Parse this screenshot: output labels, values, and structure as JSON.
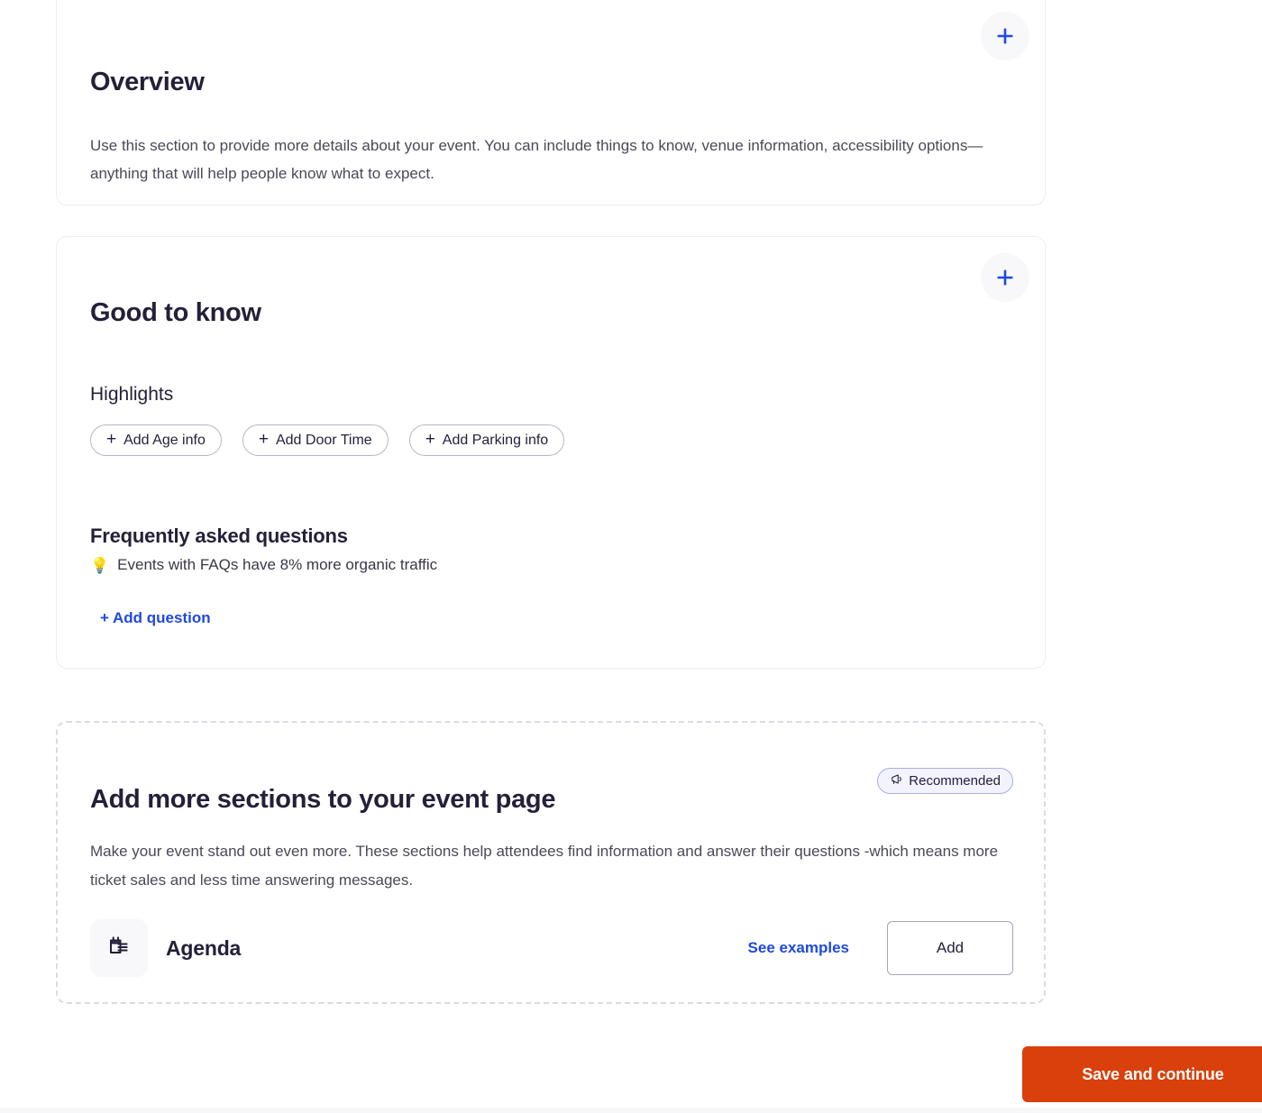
{
  "overview": {
    "title": "Overview",
    "description": "Use this section to provide more details about your event. You can include things to know, venue information, accessibility options—anything that will help people know what to expect.",
    "add_icon": "plus-icon"
  },
  "good_to_know": {
    "title": "Good to know",
    "add_icon": "plus-icon",
    "highlights": {
      "heading": "Highlights",
      "chips": [
        {
          "plus": "+",
          "label": "Add Age info"
        },
        {
          "plus": "+",
          "label": "Add Door Time"
        },
        {
          "plus": "+",
          "label": "Add Parking info"
        }
      ]
    },
    "faq": {
      "heading": "Frequently asked questions",
      "tip_icon": "💡",
      "tip_text": "Events with FAQs have 8% more organic traffic",
      "add_question_label": "+ Add question"
    }
  },
  "more_sections": {
    "title": "Add more sections to your event page",
    "badge": {
      "icon": "megaphone-icon",
      "label": "Recommended"
    },
    "description": "Make your event stand out even more. These sections help attendees find information and answer their questions -which means more ticket sales and less time answering messages.",
    "rows": [
      {
        "icon": "agenda-calendar-icon",
        "label": "Agenda",
        "link_label": "See examples",
        "button_label": "Add"
      }
    ]
  },
  "footer": {
    "save_label": "Save and continue"
  },
  "colors": {
    "accent_blue": "#1f48e3",
    "cta_orange": "#d9400b",
    "text_dark": "#251f38",
    "text_muted": "#4b4858",
    "card_border": "#eeeef2",
    "dashed_border": "#dbdbe4",
    "badge_bg": "#f2f3fd",
    "badge_border": "#a9aee8",
    "icon_box_bg": "#f8f8fa"
  }
}
